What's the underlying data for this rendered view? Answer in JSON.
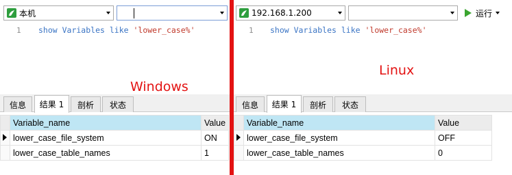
{
  "left": {
    "connection": "本机",
    "database": "",
    "editor": {
      "line_number": "1",
      "code_keyword": "show Variables like ",
      "code_string": "'lower_case%'"
    },
    "tabs": [
      "信息",
      "结果 1",
      "剖析",
      "状态"
    ],
    "active_tab": "结果 1",
    "grid": {
      "columns": [
        "Variable_name",
        "Value"
      ],
      "rows": [
        [
          "lower_case_file_system",
          "ON"
        ],
        [
          "lower_case_table_names",
          "1"
        ]
      ]
    }
  },
  "right": {
    "connection": "192.168.1.200",
    "database": "",
    "run_label": "运行",
    "editor": {
      "line_number": "1",
      "code_keyword": "show Variables like ",
      "code_string": "'lower_case%'"
    },
    "tabs": [
      "信息",
      "结果 1",
      "剖析",
      "状态"
    ],
    "active_tab": "结果 1",
    "grid": {
      "columns": [
        "Variable_name",
        "Value"
      ],
      "rows": [
        [
          "lower_case_file_system",
          "OFF"
        ],
        [
          "lower_case_table_names",
          "0"
        ]
      ]
    }
  },
  "annotations": {
    "windows_label": "Windows",
    "linux_label": "Linux",
    "color": "#e31212"
  },
  "colors": {
    "selected_header": "#bfe6f4",
    "code_keyword": "#3a74c4",
    "code_string": "#c0392b",
    "run_icon": "#3aa52f",
    "db_icon": "#2e9e3e"
  }
}
